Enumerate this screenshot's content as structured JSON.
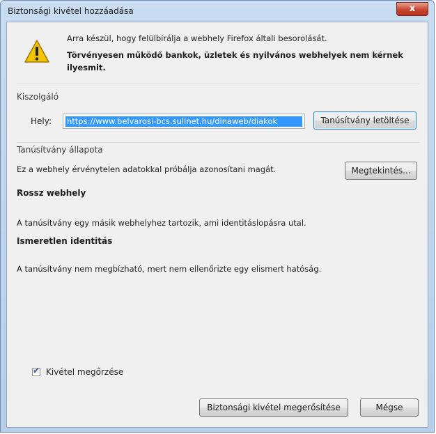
{
  "window": {
    "title": "Biztonsági kivétel hozzáadása",
    "close_glyph": "x"
  },
  "warning": {
    "line1": "Arra készül, hogy felülbírálja a webhely Firefox általi besorolását.",
    "line2": "Törvényesen működő bankok, üzletek és nyilvános webhelyek nem kérnek",
    "line3": "ilyesmit.",
    "icon": "warning-icon"
  },
  "server": {
    "group_label": "Kiszolgáló",
    "location_label": "Hely:",
    "url_value": "https://www.belvarosi-bcs.sulinet.hu/dinaweb/diakok",
    "download_button": "Tanúsítvány letöltése"
  },
  "cert_status": {
    "group_label": "Tanúsítvány állapota",
    "summary": "Ez a webhely érvénytelen adatokkal próbálja azonosítani magát.",
    "view_button": "Megtekintés...",
    "issues": [
      {
        "title": "Rossz webhely",
        "description": "A tanúsítvány egy másik webhelyhez tartozik, ami identitáslopásra utal."
      },
      {
        "title": "Ismeretlen identitás",
        "description": "A tanúsítvány nem megbízható, mert nem ellenőrizte egy elismert hatóság."
      }
    ]
  },
  "permanent": {
    "label": "Kivétel megőrzése",
    "checked": true
  },
  "footer": {
    "confirm_button": "Biztonsági kivétel megerősítése",
    "cancel_button": "Mégse"
  }
}
